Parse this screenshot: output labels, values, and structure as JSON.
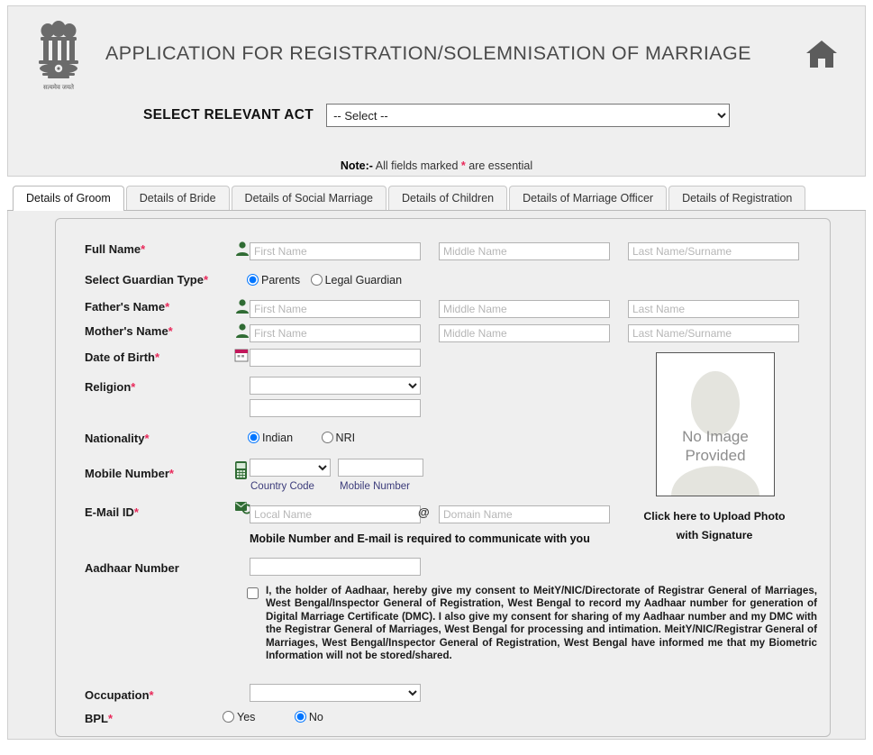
{
  "header": {
    "title": "APPLICATION FOR REGISTRATION/SOLEMNISATION OF MARRIAGE",
    "emblem_icon": "india-national-emblem-icon",
    "home_icon": "home-icon",
    "act_label": "SELECT RELEVANT ACT",
    "act_selected": "-- Select --",
    "act_options": [
      "-- Select --"
    ],
    "note_prefix": "Note:-",
    "note_text_a": " All fields marked ",
    "note_asterisk": "*",
    "note_text_b": " are essential"
  },
  "tabs": [
    {
      "label": "Details of Groom",
      "active": true
    },
    {
      "label": "Details of Bride",
      "active": false
    },
    {
      "label": "Details of Social Marriage",
      "active": false
    },
    {
      "label": "Details of Children",
      "active": false
    },
    {
      "label": "Details of Marriage Officer",
      "active": false
    },
    {
      "label": "Details of Registration",
      "active": false
    }
  ],
  "form": {
    "full_name": {
      "label": "Full Name",
      "required": "*",
      "icon": "person-icon",
      "first_placeholder": "First Name",
      "middle_placeholder": "Middle Name",
      "last_placeholder": "Last Name/Surname",
      "first_value": "",
      "middle_value": "",
      "last_value": ""
    },
    "guardian_type": {
      "label": "Select Guardian Type",
      "required": "*",
      "options": [
        "Parents",
        "Legal Guardian"
      ],
      "selected": "Parents"
    },
    "father_name": {
      "label": "Father's Name",
      "required": "*",
      "icon": "person-icon",
      "first_placeholder": "First Name",
      "middle_placeholder": "Middle Name",
      "last_placeholder": "Last Name",
      "first_value": "",
      "middle_value": "",
      "last_value": ""
    },
    "mother_name": {
      "label": "Mother's Name",
      "required": "*",
      "icon": "person-icon",
      "first_placeholder": "First Name",
      "middle_placeholder": "Middle Name",
      "last_placeholder": "Last Name/Surname",
      "first_value": "",
      "middle_value": "",
      "last_value": ""
    },
    "dob": {
      "label": "Date of Birth",
      "required": "*",
      "icon": "calendar-icon",
      "value": "",
      "placeholder": ""
    },
    "religion": {
      "label": "Religion",
      "required": "*",
      "selected": "",
      "options": [
        ""
      ],
      "sub_value": "",
      "sub_placeholder": ""
    },
    "nationality": {
      "label": "Nationality",
      "required": "*",
      "options": [
        "Indian",
        "NRI"
      ],
      "selected": "Indian"
    },
    "mobile": {
      "label": "Mobile Number",
      "required": "*",
      "icon": "mobile-phone-icon",
      "country_code_selected": "",
      "country_code_options": [
        ""
      ],
      "number_value": "",
      "country_code_caption": "Country Code",
      "number_caption": "Mobile Number"
    },
    "email": {
      "label": "E-Mail ID",
      "required": "*",
      "icon": "email-icon",
      "local_placeholder": "Local Name",
      "local_value": "",
      "at_symbol": "@",
      "domain_placeholder": "Domain Name",
      "domain_value": ""
    },
    "contact_hint": "Mobile Number and E-mail is required to communicate with you",
    "aadhaar": {
      "label": "Aadhaar Number",
      "required": "",
      "value": "",
      "placeholder": "",
      "consent_checked": false,
      "consent_text": "I, the holder of Aadhaar, hereby give my consent to MeitY/NIC/Directorate of Registrar General of Marriages, West Bengal/Inspector General of Registration, West Bengal to record my Aadhaar number for generation of Digital Marriage Certificate (DMC). I also give my consent for sharing of my Aadhaar number and my DMC with the Registrar General of Marriages, West Bengal for processing and intimation. MeitY/NIC/Registrar General of Marriages, West Bengal/Inspector General of Registration, West Bengal have informed me that my Biometric Information will not be stored/shared."
    },
    "occupation": {
      "label": "Occupation",
      "required": "*",
      "selected": "",
      "options": [
        ""
      ]
    },
    "bpl": {
      "label": "BPL",
      "required": "*",
      "options": [
        "Yes",
        "No"
      ],
      "selected": "No"
    }
  },
  "photo": {
    "no_image_line1": "No Image",
    "no_image_line2": "Provided",
    "silhouette_icon": "person-silhouette-icon",
    "caption_line1": "Click here to Upload Photo",
    "caption_line2": "with Signature"
  },
  "colors": {
    "required_asterisk": "#e8295a",
    "header_bg": "#efefef",
    "panel_bg": "#efefef",
    "title_text": "#4a4a4a",
    "person_icon_green": "#2f6b33",
    "caption_blue": "#3b3b7a"
  }
}
